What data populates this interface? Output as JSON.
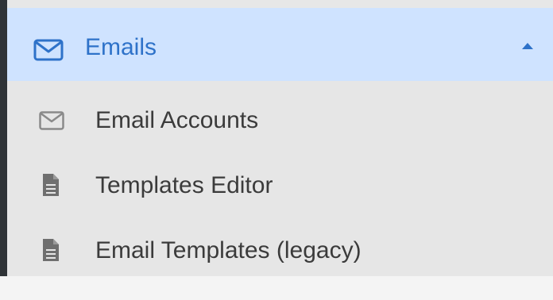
{
  "menu": {
    "section_label": "Emails",
    "section_icon": "envelope-icon",
    "section_expanded_icon": "caret-up-icon",
    "accent_color": "#2e72c9",
    "header_bg": "#cfe3ff",
    "items": [
      {
        "label": "Email Accounts",
        "icon": "envelope-icon"
      },
      {
        "label": "Templates Editor",
        "icon": "file-icon"
      },
      {
        "label": "Email Templates (legacy)",
        "icon": "file-icon"
      }
    ]
  }
}
